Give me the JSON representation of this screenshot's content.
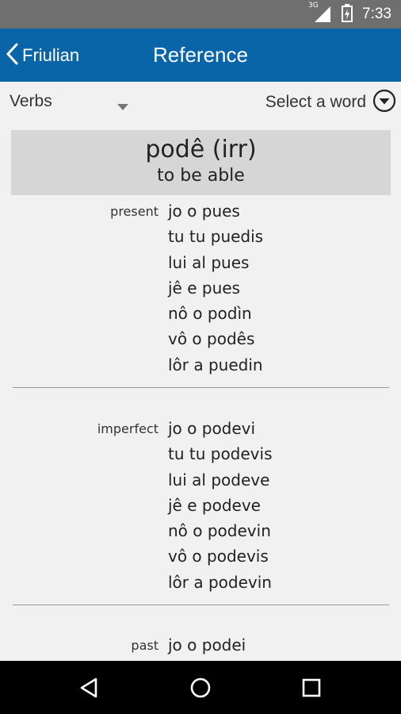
{
  "status_bar": {
    "time": "7:33",
    "network": "3G"
  },
  "app_bar": {
    "back_label": "Friulian",
    "title": "Reference"
  },
  "selectors": {
    "category": "Verbs",
    "word_placeholder": "Select a word"
  },
  "entry": {
    "word": "podê (irr)",
    "meaning": "to be able",
    "tenses": [
      {
        "name": "present",
        "forms": [
          "jo o pues",
          "tu tu puedis",
          "lui al pues",
          "jê e pues",
          "nô o podìn",
          "vô o podês",
          "lôr a puedin"
        ]
      },
      {
        "name": "imperfect",
        "forms": [
          "jo o podevi",
          "tu tu podevis",
          "lui al podeve",
          "jê e podeve",
          "nô o podevin",
          "vô o podevis",
          "lôr a podevin"
        ]
      },
      {
        "name": "past",
        "forms": [
          "jo o podei"
        ]
      }
    ]
  }
}
